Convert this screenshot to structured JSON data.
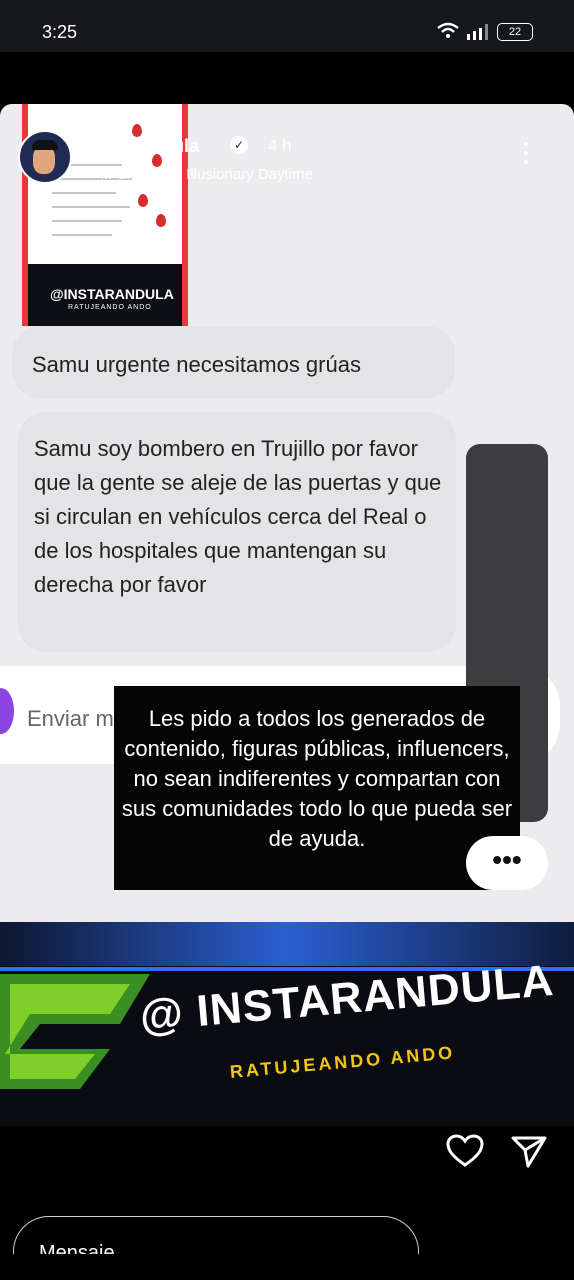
{
  "status_bar": {
    "time": "3:25",
    "battery": "22"
  },
  "story": {
    "username": "instarandula",
    "age": "4 h",
    "music": "Shurfine • Illusionary Daytime",
    "poster_brand": "@INSTARANDULA",
    "poster_tagline": "RATUJEANDO ANDO",
    "messages": [
      "Samu urgente necesitamos grúas",
      "Samu soy bombero en Trujillo por favor que la gente se aleje de las puertas y que si circulan en vehículos cerca del Real o de los hospitales que mantengan su derecha por favor"
    ],
    "reply_placeholder": "Enviar m",
    "caption": "Les pido a todos los generados de contenido, figuras públicas, influencers, no sean indiferentes y compartan con sus comunidades todo lo que pueda ser de ayuda.",
    "brand_name": "@ INSTARANDULA",
    "brand_tagline": "RATUJEANDO ANDO",
    "more_label": "•••"
  },
  "footer": {
    "message_placeholder": "Mensaje"
  },
  "colors": {
    "accent_red": "#e83838",
    "brand_yellow": "#f5c515",
    "brand_blue": "#2970ff"
  },
  "icons": [
    "wifi-icon",
    "signal-icon",
    "battery-icon",
    "verified-icon",
    "music-icon",
    "more-icon",
    "mute-icon",
    "heart-icon",
    "send-icon"
  ]
}
